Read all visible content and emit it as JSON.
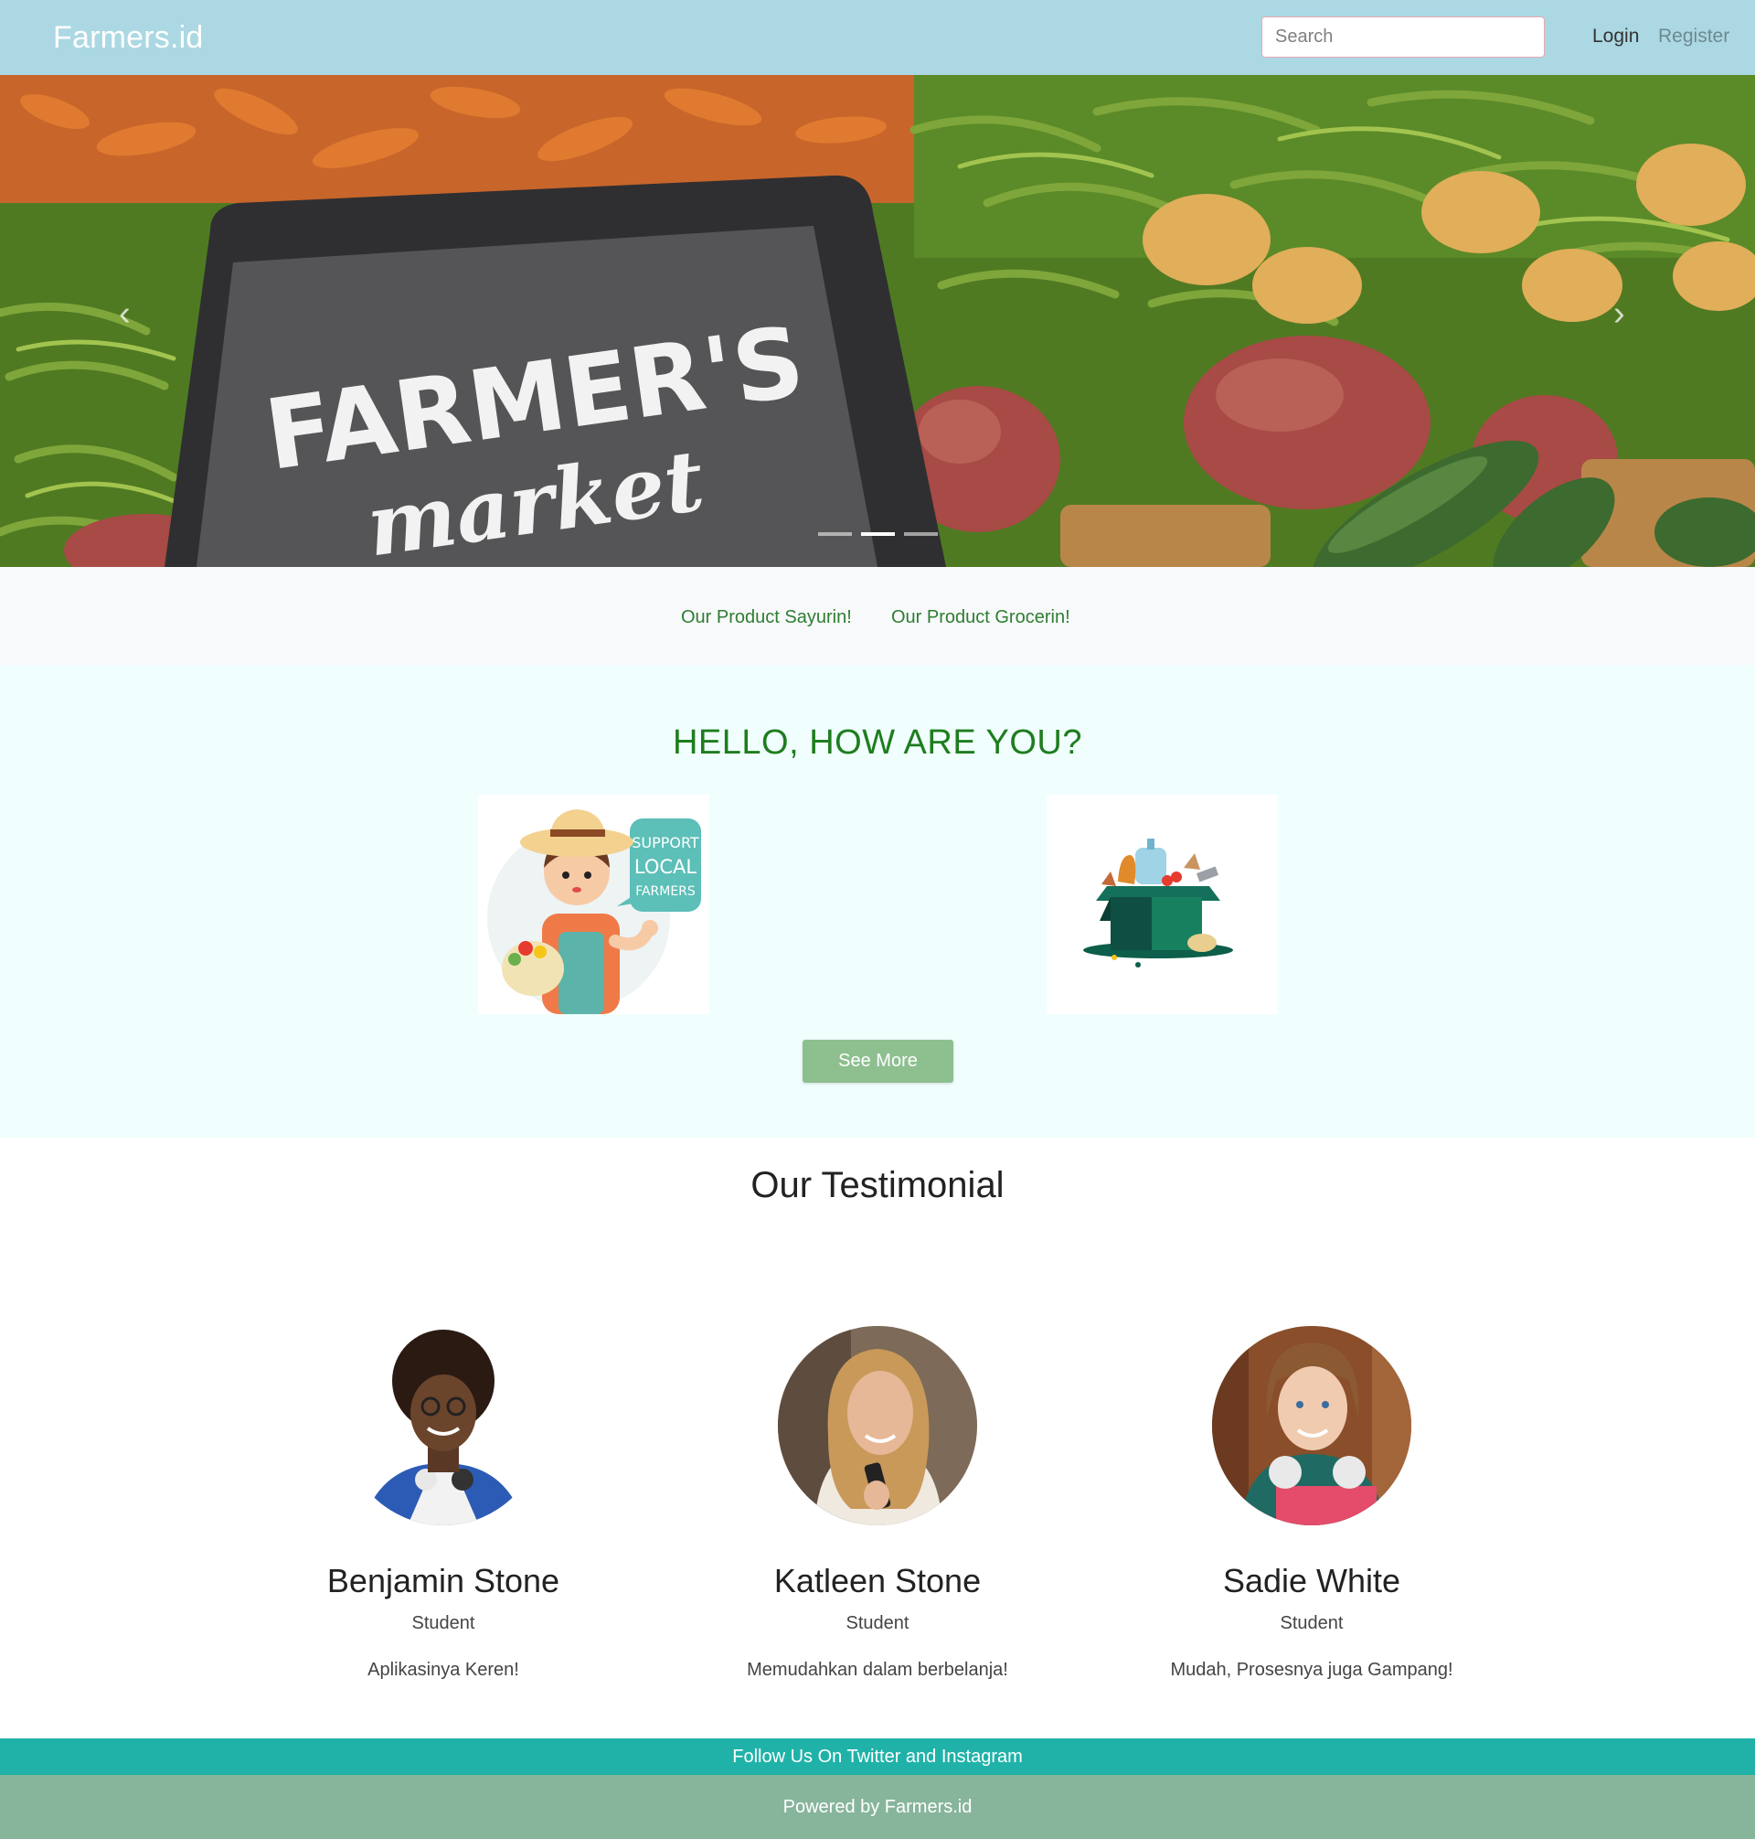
{
  "navbar": {
    "brand": "Farmers.id",
    "search_placeholder": "Search",
    "login": "Login",
    "register": "Register"
  },
  "hero": {
    "sign_line1": "FARMER'S",
    "sign_line2": "market",
    "prev_glyph": "‹",
    "next_glyph": "›",
    "slide_count": 3,
    "active_slide": 2
  },
  "products": {
    "link1": "Our Product Sayurin!",
    "link2": "Our Product Grocerin!"
  },
  "hello": {
    "title": "HELLO, HOW ARE YOU?",
    "farmer_bubble": [
      "SUPPORT",
      "LOCAL",
      "FARMERS"
    ],
    "see_more": "See More"
  },
  "testimonial": {
    "title": "Our Testimonial",
    "people": [
      {
        "name": "Benjamin Stone",
        "role": "Student",
        "quote": "Aplikasinya Keren!"
      },
      {
        "name": "Katleen Stone",
        "role": "Student",
        "quote": "Memudahkan dalam berbelanja!"
      },
      {
        "name": "Sadie White",
        "role": "Student",
        "quote": "Mudah, Prosesnya juga Gampang!"
      }
    ]
  },
  "footer": {
    "follow": "Follow Us On Twitter and Instagram",
    "powered": "Powered by Farmers.id"
  },
  "colors": {
    "navbar_bg": "#abd8e3",
    "hello_title": "#1e7d1e",
    "see_more_bg": "#8ebf8f",
    "follow_bg": "#20b2a8",
    "powered_bg": "#87b59c"
  }
}
